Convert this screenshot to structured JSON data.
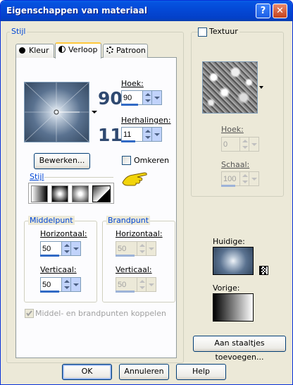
{
  "window": {
    "title": "Eigenschappen van materiaal",
    "help_label": "?",
    "close_label": "✕"
  },
  "stijl_group": {
    "legend": "Stijl"
  },
  "tabs": [
    {
      "label": "Kleur",
      "icon": "filled-circle-icon",
      "active": false
    },
    {
      "label": "Verloop",
      "icon": "half-circle-icon",
      "active": true
    },
    {
      "label": "Patroon",
      "icon": "pattern-icon",
      "active": false
    }
  ],
  "gradient": {
    "hoek_label": "Hoek:",
    "hoek_value": "90",
    "hoek_big": "90",
    "herhalingen_label": "Herhalingen:",
    "herhalingen_value": "11",
    "herhalingen_big": "11",
    "bewerken_label": "Bewerken...",
    "omkeren_label": "Omkeren",
    "omkeren_checked": false,
    "stijl_legend": "Stijl"
  },
  "middelpunt": {
    "legend": "Middelpunt",
    "horizontaal_label": "Horizontaal:",
    "horizontaal_value": "50",
    "verticaal_label": "Verticaal:",
    "verticaal_value": "50"
  },
  "brandpunt": {
    "legend": "Brandpunt",
    "horizontaal_label": "Horizontaal:",
    "horizontaal_value": "50",
    "verticaal_label": "Verticaal:",
    "verticaal_value": "50"
  },
  "koppelen": {
    "label": "Middel- en brandpunten koppelen",
    "checked": true,
    "enabled": false
  },
  "textuur": {
    "label": "Textuur",
    "checked": false,
    "hoek_label": "Hoek:",
    "hoek_value": "0",
    "schaal_label": "Schaal:",
    "schaal_value": "100"
  },
  "huidige_label": "Huidige:",
  "vorige_label": "Vorige:",
  "staaltjes_label": "Aan staaltjes toevoegen...",
  "footer": {
    "ok": "OK",
    "annuleren": "Annuleren",
    "help": "Help"
  },
  "colors": {
    "accent": "#316ac5",
    "title_bar": "#0553e0",
    "legend_text": "#0046d5"
  }
}
